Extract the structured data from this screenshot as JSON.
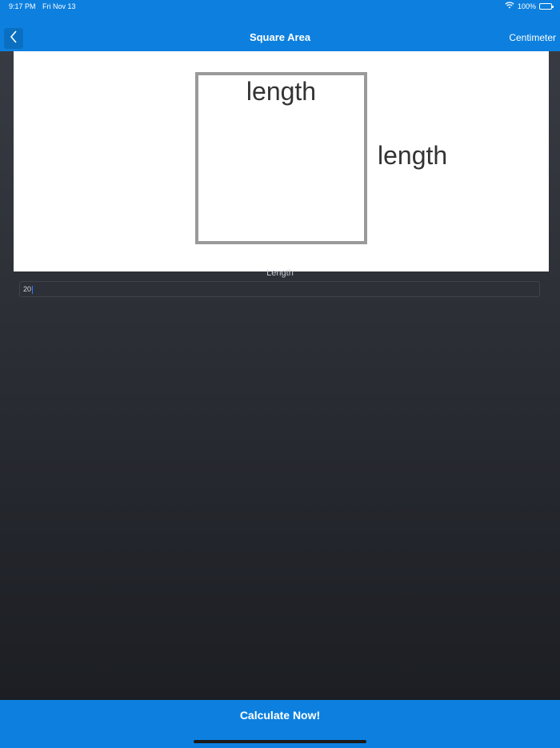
{
  "status_bar": {
    "time": "9:17 PM",
    "date": "Fri Nov 13",
    "battery": "100%"
  },
  "nav": {
    "title": "Square Area",
    "unit": "Centimeter"
  },
  "diagram": {
    "top_label": "length",
    "side_label": "length"
  },
  "form": {
    "length_label": "Length",
    "length_value": "20"
  },
  "actions": {
    "calculate_label": "Calculate Now!"
  },
  "colors": {
    "accent": "#0d80df",
    "background_top": "#3a3d45",
    "background_bottom": "#1a1c21"
  }
}
